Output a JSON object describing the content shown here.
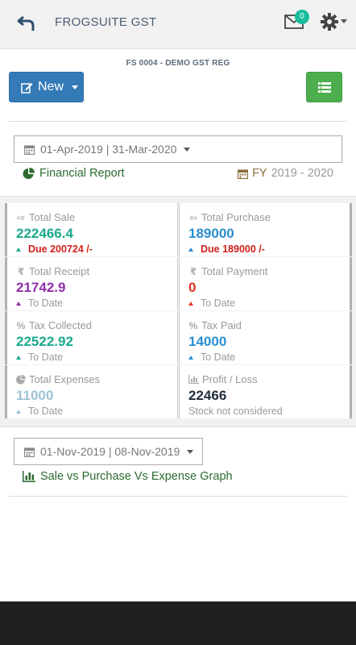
{
  "header": {
    "title": "FROGSUITE GST",
    "mail_count": "0",
    "back_icon": "back-arrow-icon",
    "mail_icon": "envelope-icon",
    "settings_icon": "gear-icon"
  },
  "registration": "FS 0004 - DEMO GST REG",
  "toolbar": {
    "new_label": "New",
    "list_icon": "list-icon"
  },
  "report_filter": {
    "date_range": "01-Apr-2019 | 31-Mar-2020",
    "link_label": "Financial Report",
    "fy_label": "FY",
    "fy_value": "2019 - 2020"
  },
  "stats": {
    "total_sale": {
      "label": "Total Sale",
      "value": "222466.4",
      "sub": "Due 200724 /-",
      "color": "#1aaa8c"
    },
    "total_purchase": {
      "label": "Total Purchase",
      "value": "189000",
      "sub": "Due 189000 /-",
      "color": "#2a8fd0"
    },
    "total_receipt": {
      "label": "Total Receipt",
      "value": "21742.9",
      "sub": "To Date",
      "color": "#8e2fa8"
    },
    "total_payment": {
      "label": "Total Payment",
      "value": "0",
      "sub": "To Date",
      "color": "#e0301e"
    },
    "tax_collected": {
      "label": "Tax Collected",
      "value": "22522.92",
      "sub": "To Date",
      "color": "#1aaa8c"
    },
    "tax_paid": {
      "label": "Tax Paid",
      "value": "14000",
      "sub": "To Date",
      "color": "#2a8fd0"
    },
    "total_expenses": {
      "label": "Total Expenses",
      "value": "11000",
      "sub": "To Date",
      "color": "#9ec3d6"
    },
    "profit_loss": {
      "label": "Profit / Loss",
      "value": "22466",
      "sub": "Stock not considered",
      "color": "#222e3c"
    }
  },
  "graph_filter": {
    "date_range": "01-Nov-2019 | 08-Nov-2019",
    "link_label": "Sale vs Purchase Vs Expense Graph"
  }
}
